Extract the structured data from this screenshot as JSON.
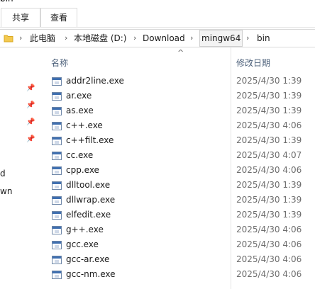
{
  "window": {
    "title_fragment": "bin"
  },
  "ribbon": {
    "tabs": [
      "共享",
      "查看"
    ]
  },
  "address": {
    "crumbs": [
      "此电脑",
      "本地磁盘 (D:)",
      "Download",
      "mingw64",
      "bin"
    ],
    "icon": "folder-icon"
  },
  "nav": {
    "fragments": [
      "d",
      "wn"
    ],
    "pin_icon": "pin-icon"
  },
  "columns": {
    "name": "名称",
    "modified": "修改日期"
  },
  "files": [
    {
      "name": "addr2line.exe",
      "date": "2025/4/30 1:39"
    },
    {
      "name": "ar.exe",
      "date": "2025/4/30 1:39"
    },
    {
      "name": "as.exe",
      "date": "2025/4/30 1:39"
    },
    {
      "name": "c++.exe",
      "date": "2025/4/30 4:06"
    },
    {
      "name": "c++filt.exe",
      "date": "2025/4/30 1:39"
    },
    {
      "name": "cc.exe",
      "date": "2025/4/30 4:07"
    },
    {
      "name": "cpp.exe",
      "date": "2025/4/30 4:06"
    },
    {
      "name": "dlltool.exe",
      "date": "2025/4/30 1:39"
    },
    {
      "name": "dllwrap.exe",
      "date": "2025/4/30 1:39"
    },
    {
      "name": "elfedit.exe",
      "date": "2025/4/30 1:39"
    },
    {
      "name": "g++.exe",
      "date": "2025/4/30 4:06"
    },
    {
      "name": "gcc.exe",
      "date": "2025/4/30 4:06"
    },
    {
      "name": "gcc-ar.exe",
      "date": "2025/4/30 4:06"
    },
    {
      "name": "gcc-nm.exe",
      "date": "2025/4/30 4:06"
    }
  ]
}
